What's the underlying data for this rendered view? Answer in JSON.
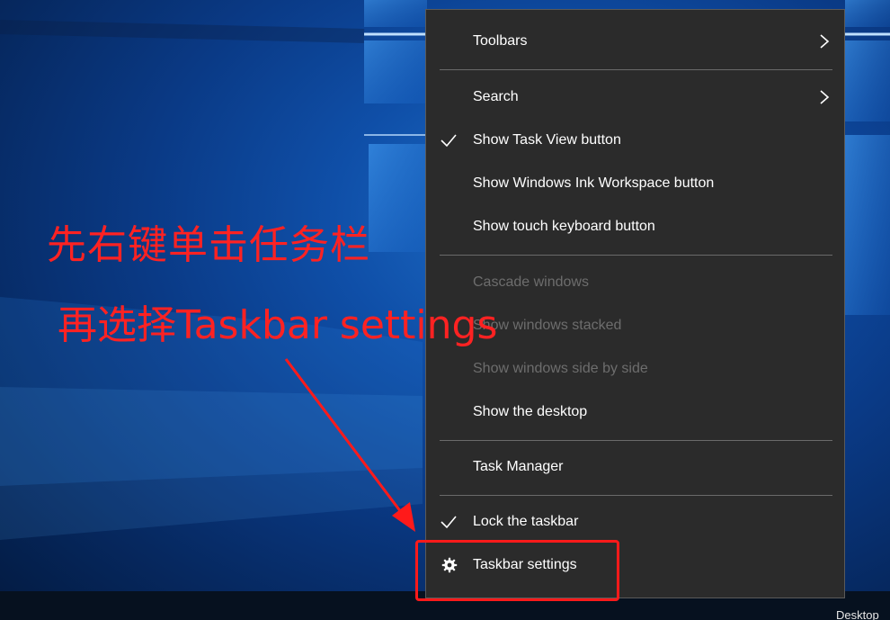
{
  "menu": {
    "items": [
      {
        "label": "Toolbars",
        "submenu": true,
        "checked": false,
        "disabled": false
      },
      {
        "label": "Search",
        "submenu": true,
        "checked": false,
        "disabled": false
      },
      {
        "label": "Show Task View button",
        "submenu": false,
        "checked": true,
        "disabled": false
      },
      {
        "label": "Show Windows Ink Workspace button",
        "submenu": false,
        "checked": false,
        "disabled": false
      },
      {
        "label": "Show touch keyboard button",
        "submenu": false,
        "checked": false,
        "disabled": false
      },
      {
        "label": "Cascade windows",
        "submenu": false,
        "checked": false,
        "disabled": true
      },
      {
        "label": "Show windows stacked",
        "submenu": false,
        "checked": false,
        "disabled": true
      },
      {
        "label": "Show windows side by side",
        "submenu": false,
        "checked": false,
        "disabled": true
      },
      {
        "label": "Show the desktop",
        "submenu": false,
        "checked": false,
        "disabled": false
      },
      {
        "label": "Task Manager",
        "submenu": false,
        "checked": false,
        "disabled": false
      },
      {
        "label": "Lock the taskbar",
        "submenu": false,
        "checked": true,
        "disabled": false
      },
      {
        "label": "Taskbar settings",
        "submenu": false,
        "checked": false,
        "disabled": false,
        "icon": "gear-icon"
      }
    ]
  },
  "annotation": {
    "line1": "先右键单击任务栏",
    "line2": "再选择Taskbar settings",
    "color": "#ff2222"
  },
  "taskbar": {
    "label": "Desktop"
  },
  "colors": {
    "menu_bg": "#2b2b2b",
    "menu_text": "#ffffff",
    "menu_disabled_text": "#6d6d6d",
    "separator": "#6a6a6a",
    "highlight": "#ff1a1a"
  }
}
